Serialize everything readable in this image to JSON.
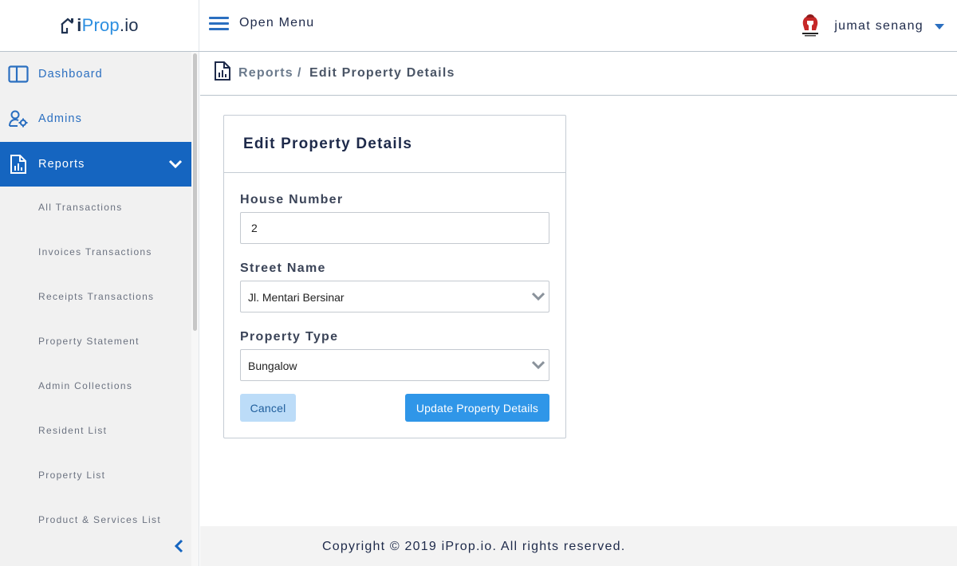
{
  "logo": {
    "i": "i",
    "prop": "Prop",
    "dot": ".",
    "io": "io"
  },
  "topbar": {
    "menu_label": "Open Menu",
    "user_name": "jumat senang"
  },
  "sidebar": {
    "items": [
      {
        "label": "Dashboard",
        "icon": "dashboard-icon"
      },
      {
        "label": "Admins",
        "icon": "admin-gear-icon"
      },
      {
        "label": "Reports",
        "icon": "report-icon",
        "active": true
      }
    ],
    "sub_items": [
      "All Transactions",
      "Invoices Transactions",
      "Receipts Transactions",
      "Property Statement",
      "Admin Collections",
      "Resident List",
      "Property List",
      "Product & Services List"
    ]
  },
  "breadcrumb": {
    "parent": "Reports",
    "separator": "/",
    "current": "Edit Property Details"
  },
  "form": {
    "title": "Edit Property Details",
    "house_number": {
      "label": "House Number",
      "value": "2"
    },
    "street_name": {
      "label": "Street Name",
      "value": "Jl. Mentari Bersinar"
    },
    "property_type": {
      "label": "Property Type",
      "value": "Bungalow"
    },
    "cancel_label": "Cancel",
    "submit_label": "Update Property Details"
  },
  "footer": {
    "text": "Copyright © 2019 iProp.io. All rights reserved."
  },
  "colors": {
    "primary": "#1565c0",
    "accent": "#2f96e8",
    "cancel_bg": "#bcdcf8",
    "sidebar_bg": "#f1f1f1"
  }
}
